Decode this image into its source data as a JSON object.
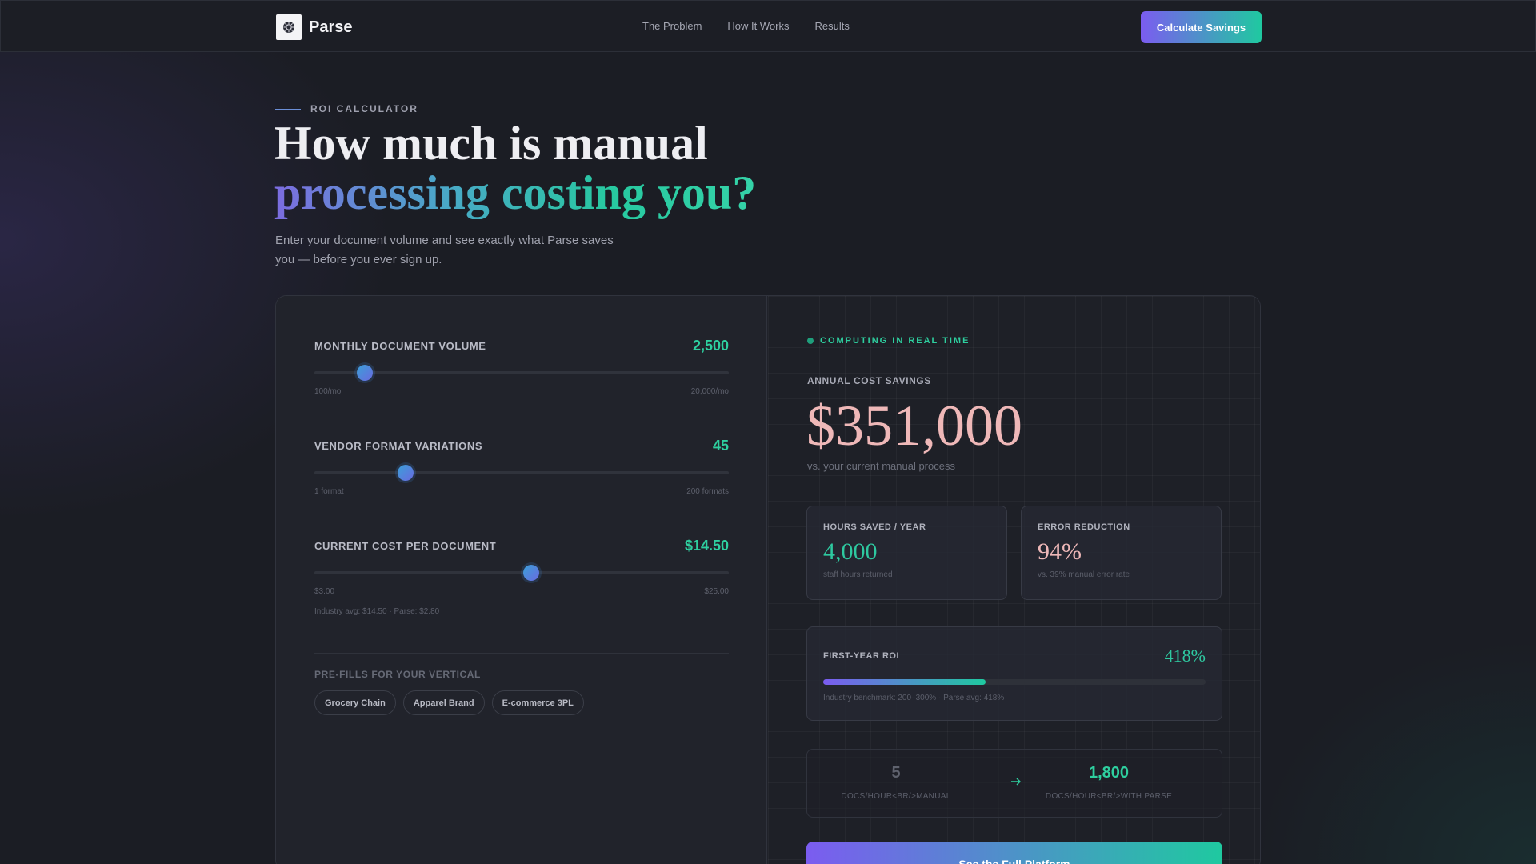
{
  "nav": {
    "logo_text": "Parse",
    "links": [
      "The Problem",
      "How It Works",
      "Results"
    ],
    "cta_label": "Calculate Savings"
  },
  "hero": {
    "eyebrow": "ROI CALCULATOR",
    "title_line1": "How much is manual",
    "title_line2": "processing costing you?",
    "subtitle": "Enter your document volume and see exactly what Parse saves you — before you ever sign up."
  },
  "inputs": {
    "sliders": [
      {
        "label": "MONTHLY DOCUMENT VOLUME",
        "value_text": "2,500",
        "fraction": 0.121,
        "min_label": "100/mo",
        "max_label": "20,000/mo"
      },
      {
        "label": "VENDOR FORMAT VARIATIONS",
        "value_text": "45",
        "fraction": 0.221,
        "min_label": "1 format",
        "max_label": "200 formats"
      },
      {
        "label": "CURRENT COST PER DOCUMENT",
        "value_text": "$14.50",
        "fraction": 0.523,
        "min_label": "$3.00",
        "max_label": "$25.00",
        "hint": "Industry avg: $14.50 · Parse: $2.80"
      }
    ],
    "prefill_label": "PRE-FILLS FOR YOUR VERTICAL",
    "prefills": [
      "Grocery Chain",
      "Apparel Brand",
      "E-commerce 3PL"
    ]
  },
  "results": {
    "live_label": "COMPUTING IN REAL TIME",
    "savings_label": "ANNUAL COST SAVINGS",
    "savings_value": "$351,000",
    "savings_sub": "vs. your current manual process",
    "stats": [
      {
        "label": "HOURS SAVED / YEAR",
        "value": "4,000",
        "sub": "staff hours returned",
        "color": "#2ec9a0"
      },
      {
        "label": "ERROR REDUCTION",
        "value": "94%",
        "sub": "vs. 39% manual error rate",
        "color": "#efb8b8"
      }
    ],
    "roi": {
      "label": "FIRST-YEAR ROI",
      "value": "418%",
      "fraction": 0.425,
      "sub": "Industry benchmark: 200–300% · Parse avg: 418%"
    },
    "compare": {
      "manual_value": "5",
      "manual_label": "DOCS/HOUR<BR/>MANUAL",
      "parse_value": "1,800",
      "parse_label": "DOCS/HOUR<BR/>WITH PARSE"
    },
    "cta_label": "See the Full Platform"
  },
  "colors": {
    "accent_green": "#2ecf9f",
    "accent_purple": "#7b5cf0",
    "savings_pink": "#efb8b8",
    "background": "#1b1d24"
  },
  "icons": [
    "parse-logo-icon",
    "live-dot-icon",
    "arrow-right-icon"
  ]
}
